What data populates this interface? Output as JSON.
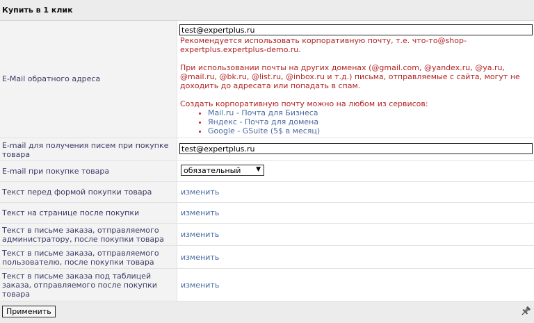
{
  "header": {
    "title": "Купить в 1 клик"
  },
  "fields": {
    "return_email": {
      "label": "E-Mail обратного адреса",
      "value": "test@expertplus.ru",
      "hint_line1": "Рекомендуется использовать корпоративную почту, т.е. что-то@shop-",
      "hint_line2": "expertplus.expertplus-demo.ru.",
      "hint_line3": "При использовании почты на других доменах (@gmail.com, @yandex.ru, @ya.ru,",
      "hint_line4": "@mail.ru, @bk.ru, @list.ru, @inbox.ru и т.д.) письма, отправляемые с сайта, могут не",
      "hint_line5": "доходить до адресата или попадать в спам.",
      "hint_line6": "Создать корпоративную почту можно на любом из сервисов:",
      "services": [
        {
          "name": "Mail.ru",
          "desc": "Почта для Бизнеса"
        },
        {
          "name": "Яндекс",
          "desc": "Почта для домена"
        },
        {
          "name": "Google",
          "desc": "GSuite (5$ в месяц)"
        }
      ]
    },
    "order_email": {
      "label_line1": "E-mail для получения писем при покупке",
      "label_line2": "товара",
      "value": "test@expertplus.ru"
    },
    "purchase_email": {
      "label": "E-mail при покупке товара",
      "selected": "обязательный"
    },
    "text_before_form": {
      "label": "Текст перед формой покупки товара",
      "link": "изменить"
    },
    "text_after_purchase": {
      "label": "Текст на странице после покупки",
      "link": "изменить"
    },
    "admin_email_text": {
      "label_line1": "Текст в письме заказа, отправляемого",
      "label_line2": "администратору, после покупки товара",
      "link": "изменить"
    },
    "user_email_text": {
      "label_line1": "Текст в письме заказа, отправляемого",
      "label_line2": "пользователю, после покупки товара",
      "link": "изменить"
    },
    "under_table_text": {
      "label_line1": "Текст в письме заказа под таблицей",
      "label_line2": "заказа, отправляемого после покупки",
      "label_line3": "товара",
      "link": "изменить"
    }
  },
  "footer": {
    "apply_label": "Применить",
    "pin_icon": "pin-icon"
  },
  "colors": {
    "hint": "#b22222",
    "link": "#4a6aa5",
    "label": "#3a3a66"
  }
}
